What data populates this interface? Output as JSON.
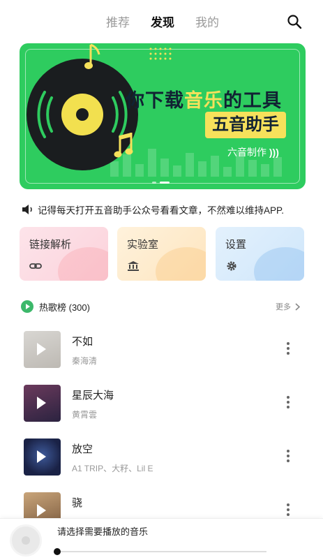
{
  "tabs": [
    {
      "label": "推荐",
      "active": false
    },
    {
      "label": "发现",
      "active": true
    },
    {
      "label": "我的",
      "active": false
    }
  ],
  "banner": {
    "headline_pre": "你下载",
    "headline_hl": "音乐",
    "headline_post": "的工具",
    "subtitle": "五音助手",
    "maker": "六音制作",
    "bg_color": "#2ecc5f",
    "accent_color": "#f6e15b"
  },
  "notice": {
    "text": "记得每天打开五音助手公众号看看文章，不然难以维持APP."
  },
  "cards": [
    {
      "label": "链接解析",
      "icon": "link-icon"
    },
    {
      "label": "实验室",
      "icon": "bank-icon"
    },
    {
      "label": "设置",
      "icon": "gear-icon"
    }
  ],
  "hot_list": {
    "title": "热歌榜 (300)",
    "more_label": "更多"
  },
  "songs": [
    {
      "title": "不如",
      "artist": "秦海清"
    },
    {
      "title": "星辰大海",
      "artist": "黄霄雲"
    },
    {
      "title": "放空",
      "artist": "A1 TRIP、大籽、Lil E"
    },
    {
      "title": "骁",
      "artist": ""
    }
  ],
  "player": {
    "prompt": "请选择需要播放的音乐",
    "progress": 0.0
  }
}
